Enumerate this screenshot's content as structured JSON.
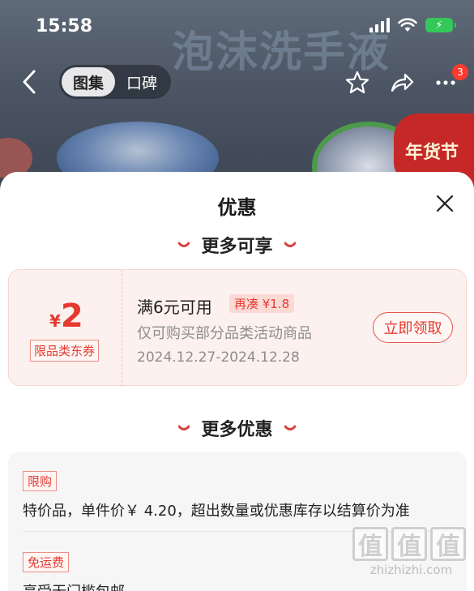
{
  "status": {
    "time": "15:58"
  },
  "header": {
    "bg_title": "泡沫洗手液",
    "tabs": [
      {
        "label": "图集",
        "active": true
      },
      {
        "label": "口碑",
        "active": false
      }
    ],
    "more_badge": "3",
    "promo_badge": "年货节"
  },
  "sheet": {
    "title": "优惠",
    "section1": "更多可享",
    "coupon": {
      "currency": "¥",
      "amount": "2",
      "category_tag": "限品类东券",
      "condition": "满6元可用",
      "topup_tag": "再凑 ¥1.8",
      "description": "仅可购买部分品类活动商品",
      "validity": "2024.12.27-2024.12.28",
      "claim_label": "立即领取"
    },
    "section2": "更多优惠",
    "promos": [
      {
        "tag": "限购",
        "text": "特价品，单件价￥ 4.20，超出数量或优惠库存以结算价为准"
      },
      {
        "tag": "免运费",
        "text": "享受无门槛包邮"
      }
    ]
  },
  "watermark": {
    "logo": [
      "值",
      "值",
      "值"
    ],
    "url": "zhizhizhi.com"
  },
  "colors": {
    "accent": "#e53a2f",
    "coupon_bg": "#fdf1ef",
    "battery": "#34c759"
  }
}
